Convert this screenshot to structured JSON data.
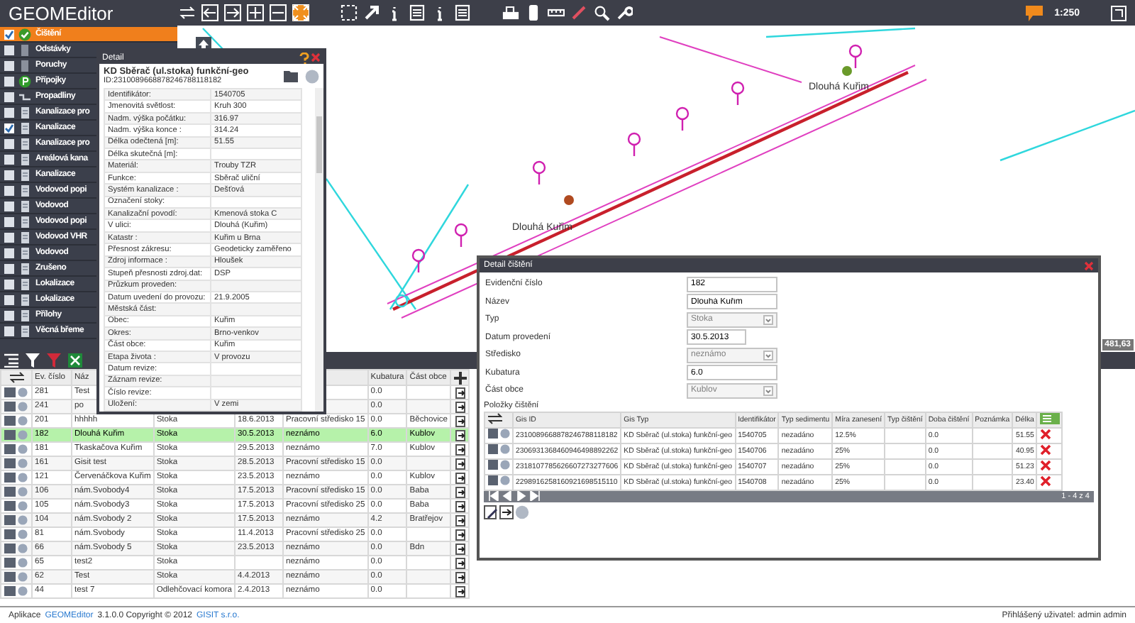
{
  "app": {
    "title": "GEOMEditor",
    "scale": "1:250"
  },
  "toolbar": [
    {
      "kind": "swap",
      "selected": false
    },
    {
      "kind": "undo",
      "selected": false
    },
    {
      "kind": "redo",
      "selected": false
    },
    {
      "kind": "plus",
      "selected": false
    },
    {
      "kind": "minus",
      "selected": false
    },
    {
      "kind": "fit",
      "selected": true
    },
    {
      "kind": "select",
      "selected": false
    },
    {
      "kind": "pointer",
      "selected": false
    },
    {
      "kind": "info",
      "selected": false
    },
    {
      "kind": "table",
      "selected": false
    },
    {
      "kind": "info",
      "selected": false
    },
    {
      "kind": "table",
      "selected": false
    },
    {
      "kind": "print",
      "selected": false
    },
    {
      "kind": "device",
      "selected": false
    },
    {
      "kind": "ruler",
      "selected": false
    },
    {
      "kind": "pencil",
      "selected": false
    },
    {
      "kind": "search",
      "selected": false
    },
    {
      "kind": "wrench",
      "selected": false
    }
  ],
  "layers": [
    {
      "label": "Čištění",
      "checked": true,
      "selected": true,
      "kind": "check"
    },
    {
      "label": "Odstávky",
      "checked": false,
      "selected": false,
      "kind": "bar"
    },
    {
      "label": "Poruchy",
      "checked": false,
      "selected": false,
      "kind": "bar"
    },
    {
      "label": "Přípojky",
      "checked": false,
      "selected": false,
      "kind": "badge"
    },
    {
      "label": "Propadliny",
      "checked": false,
      "selected": false,
      "kind": "line"
    },
    {
      "label": "Kanalizace pro",
      "checked": false,
      "selected": false,
      "kind": "doc"
    },
    {
      "label": "Kanalizace",
      "checked": true,
      "selected": false,
      "kind": "doc"
    },
    {
      "label": "Kanalizace pro",
      "checked": false,
      "selected": false,
      "kind": "doc"
    },
    {
      "label": "Areálová kana",
      "checked": false,
      "selected": false,
      "kind": "doc"
    },
    {
      "label": "Kanalizace",
      "checked": false,
      "selected": false,
      "kind": "doc"
    },
    {
      "label": "Vodovod popi",
      "checked": false,
      "selected": false,
      "kind": "doc"
    },
    {
      "label": "Vodovod",
      "checked": false,
      "selected": false,
      "kind": "doc"
    },
    {
      "label": "Vodovod popi",
      "checked": false,
      "selected": false,
      "kind": "doc"
    },
    {
      "label": "Vodovod VHR",
      "checked": false,
      "selected": false,
      "kind": "doc"
    },
    {
      "label": "Vodovod",
      "checked": false,
      "selected": false,
      "kind": "doc"
    },
    {
      "label": "Zrušeno",
      "checked": false,
      "selected": false,
      "kind": "doc"
    },
    {
      "label": "Lokalizace",
      "checked": false,
      "selected": false,
      "kind": "doc"
    },
    {
      "label": "Lokalizace",
      "checked": false,
      "selected": false,
      "kind": "doc"
    },
    {
      "label": "Přílohy",
      "checked": false,
      "selected": false,
      "kind": "doc"
    },
    {
      "label": "Věcná břeme",
      "checked": false,
      "selected": false,
      "kind": "doc"
    }
  ],
  "map": {
    "labels": [
      "Dlouhá Kuřim",
      "Dlouhá Kuřim"
    ],
    "coordinate": "481,63"
  },
  "detail": {
    "title": "Detail",
    "object_type": "KD Sběrač (ul.stoka) funkční-geo",
    "object_id": "ID:2310089668878246788118182",
    "properties": [
      {
        "label": "Identifikátor:",
        "value": "1540705"
      },
      {
        "label": "Jmenovitá světlost:",
        "value": "Kruh 300"
      },
      {
        "label": "Nadm. výška počátku:",
        "value": "316.97"
      },
      {
        "label": "Nadm. výška konce :",
        "value": "314.24"
      },
      {
        "label": "Délka odečtená [m]:",
        "value": "51.55"
      },
      {
        "label": "Délka skutečná [m]:"
      },
      {
        "label": "Materiál:",
        "value": "Trouby TZR"
      },
      {
        "label": "Funkce:",
        "value": "Sběrač uliční"
      },
      {
        "label": "Systém kanalizace :",
        "value": "Dešťová"
      },
      {
        "label": "Označení stoky:"
      },
      {
        "label": "Kanalizační povodí:",
        "value": "Kmenová stoka C"
      },
      {
        "label": "V ulici:",
        "value": "Dlouhá (Kuřim)"
      },
      {
        "label": "Katastr :",
        "value": "Kuřim u Brna"
      },
      {
        "label": "Přesnost zákresu:",
        "value": "Geodeticky zaměřeno"
      },
      {
        "label": "Zdroj informace :",
        "value": "Hloušek"
      },
      {
        "label": "Stupeň přesnosti zdroj.dat:",
        "value": "DSP"
      },
      {
        "label": "Průzkum proveden:"
      },
      {
        "label": "Datum uvedení do provozu:",
        "value": "21.9.2005"
      },
      {
        "label": "Městská část:"
      },
      {
        "label": "Obec:",
        "value": "Kuřim"
      },
      {
        "label": "Okres:",
        "value": "Brno-venkov"
      },
      {
        "label": "Část obce:",
        "value": "Kuřim"
      },
      {
        "label": "Etapa života :",
        "value": "V provozu"
      },
      {
        "label": "Datum revize:"
      },
      {
        "label": "Záznam revize:"
      },
      {
        "label": "Číslo revize:"
      },
      {
        "label": "Uložení:",
        "value": "V zemi"
      }
    ]
  },
  "grid": {
    "columns": [
      {
        "label": "Ev. číslo"
      },
      {
        "label": "Náz"
      },
      {},
      {},
      {},
      {
        "label": "Kubatura"
      },
      {
        "label": "Část obce"
      }
    ],
    "rows": [
      {
        "selected": false,
        "ev": "281",
        "name": "Test",
        "volume": "0.0"
      },
      {
        "selected": false,
        "ev": "241",
        "name": "po",
        "volume": "0.0"
      },
      {
        "selected": false,
        "ev": "201",
        "name": "hhhhh",
        "type": "Stoka",
        "date": "18.6.2013",
        "center": "Pracovní středisko 15",
        "volume": "0.0",
        "part": "Běchovice"
      },
      {
        "selected": true,
        "ev": "182",
        "name": "Dlouhá Kuřim",
        "type": "Stoka",
        "date": "30.5.2013",
        "center": "neznámo",
        "volume": "6.0",
        "part": "Kublov"
      },
      {
        "selected": false,
        "ev": "181",
        "name": "Tkaskačova Kuřim",
        "type": "Stoka",
        "date": "29.5.2013",
        "center": "neznámo",
        "volume": "7.0",
        "part": "Kublov"
      },
      {
        "selected": false,
        "ev": "161",
        "name": "Gisit test",
        "type": "Stoka",
        "date": "28.5.2013",
        "center": "Pracovní středisko 15",
        "volume": "0.0"
      },
      {
        "selected": false,
        "ev": "121",
        "name": "Červenáčkova Kuřim",
        "type": "Stoka",
        "date": "23.5.2013",
        "center": "neznámo",
        "volume": "0.0",
        "part": "Kublov"
      },
      {
        "selected": false,
        "ev": "106",
        "name": "nám.Svobody4",
        "type": "Stoka",
        "date": "17.5.2013",
        "center": "Pracovní středisko 15",
        "volume": "0.0",
        "part": "Baba"
      },
      {
        "selected": false,
        "ev": "105",
        "name": "nám.Svobody3",
        "type": "Stoka",
        "date": "17.5.2013",
        "center": "Pracovní středisko 25",
        "volume": "0.0",
        "part": "Baba"
      },
      {
        "selected": false,
        "ev": "104",
        "name": "nám.Svobody 2",
        "type": "Stoka",
        "date": "17.5.2013",
        "center": "neznámo",
        "volume": "4.2",
        "part": "Bratřejov"
      },
      {
        "selected": false,
        "ev": "81",
        "name": "nám.Svobody",
        "type": "Stoka",
        "date": "11.4.2013",
        "center": "Pracovní středisko 25",
        "volume": "0.0"
      },
      {
        "selected": false,
        "ev": "66",
        "name": "nám.Svobody 5",
        "type": "Stoka",
        "date": "23.5.2013",
        "center": "neznámo",
        "volume": "0.0",
        "part": "Bdn"
      },
      {
        "selected": false,
        "ev": "65",
        "name": "test2",
        "type": "Stoka",
        "center": "neznámo",
        "volume": "0.0"
      },
      {
        "selected": false,
        "ev": "62",
        "name": "Test",
        "type": "Stoka",
        "date": "4.4.2013",
        "center": "neznámo",
        "volume": "0.0"
      },
      {
        "selected": false,
        "ev": "44",
        "name": "test 7",
        "type": "Odlehčovací komora",
        "date": "2.4.2013",
        "center": "neznámo",
        "volume": "0.0"
      }
    ]
  },
  "cleaning_dialog": {
    "title": "Detail čištění",
    "fields": [
      {
        "label": "Evidenční číslo",
        "value": "182",
        "kind": "text"
      },
      {
        "label": "Název",
        "value": "Dlouhá Kuřim",
        "kind": "text"
      },
      {
        "label": "Typ",
        "value": "Stoka",
        "kind": "select"
      },
      {
        "label": "Datum provedení",
        "value": "30.5.2013",
        "kind": "date"
      },
      {
        "label": "Středisko",
        "value": "neznámo",
        "kind": "select"
      },
      {
        "label": "Kubatura",
        "value": "6.0",
        "kind": "text"
      },
      {
        "label": "Část obce",
        "value": "Kublov",
        "kind": "select"
      }
    ],
    "items_title": "Položky čištění",
    "columns": [
      "Gis ID",
      "Gis Typ",
      "Identifikátor",
      "Typ sedimentu",
      "Míra zanesení",
      "Typ čištění",
      "Doba čištění",
      "Poznámka",
      "Délka"
    ],
    "rows": [
      {
        "gis_id": "2310089668878246788118182",
        "gis_type": "KD Sběrač (ul.stoka) funkční-geo",
        "identifier": "1540705",
        "sediment": "nezadáno",
        "fouling": "12.5%",
        "duration": "0.0",
        "length": "51.55"
      },
      {
        "gis_id": "2306931368460946498892262",
        "gis_type": "KD Sběrač (ul.stoka) funkční-geo",
        "identifier": "1540706",
        "sediment": "nezadáno",
        "fouling": "25%",
        "duration": "0.0",
        "length": "40.95"
      },
      {
        "gis_id": "2318107785626607273277606",
        "gis_type": "KD Sběrač (ul.stoka) funkční-geo",
        "identifier": "1540707",
        "sediment": "nezadáno",
        "fouling": "25%",
        "duration": "0.0",
        "length": "51.23"
      },
      {
        "gis_id": "2298916258160921698515110",
        "gis_type": "KD Sběrač (ul.stoka) funkční-geo",
        "identifier": "1540708",
        "sediment": "nezadáno",
        "fouling": "25%",
        "duration": "0.0",
        "length": "23.40"
      }
    ],
    "pager": "1 - 4 z 4"
  },
  "status_bar": {
    "prefix": "Aplikace",
    "app_link": "GEOMEditor",
    "middle": "3.1.0.0 Copyright © 2012",
    "company_link": "GISIT s.r.o.",
    "user": "Přihlášený uživatel: admin admin"
  }
}
